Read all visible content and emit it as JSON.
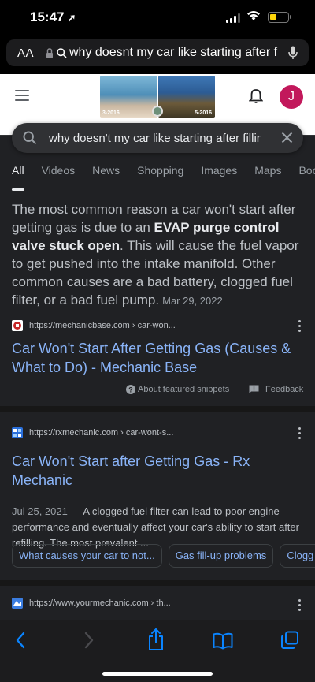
{
  "status_bar": {
    "time": "15:47"
  },
  "browser": {
    "aa_label": "AA",
    "url_text": "why doesnt my car like starting after f"
  },
  "google": {
    "doodle": {
      "left_label": "3-2016",
      "right_label": "5-2016"
    },
    "avatar_letter": "J",
    "search_query": "why doesn't my car like starting after filling",
    "tabs": [
      "All",
      "Videos",
      "News",
      "Shopping",
      "Images",
      "Maps",
      "Boo"
    ]
  },
  "featured_snippet": {
    "text_before": "The most common reason a car won't start after getting gas is due to an ",
    "bold": "EVAP purge control valve stuck open",
    "text_after": ". This will cause the fuel vapor to get pushed into the intake manifold. Other common causes are a bad battery, clogged fuel filter, or a bad fuel pump.",
    "date": "Mar 29, 2022",
    "source_url": "https://mechanicbase.com",
    "source_path": " › car-won...",
    "title": "Car Won't Start After Getting Gas (Causes & What to Do) - Mechanic Base",
    "about_label": "About featured snippets",
    "feedback_label": "Feedback"
  },
  "results": [
    {
      "url": "https://rxmechanic.com",
      "path": " › car-wont-s...",
      "title": "Car Won't Start after Getting Gas - Rx Mechanic",
      "date": "Jul 25, 2021",
      "description": " — A clogged fuel filter can lead to poor engine performance and eventually affect your car's ability to start after refilling. The most prevalent ...",
      "chips": [
        "What causes your car to not...",
        "Gas fill-up problems",
        "Clogg"
      ]
    },
    {
      "url": "https://www.yourmechanic.com",
      "path": " › th..."
    }
  ],
  "colors": {
    "background": "#202124",
    "link": "#8ab4f8",
    "avatar": "#c2185b",
    "toolbar_icons": "#0a84ff"
  },
  "icons": [
    "location-arrow-icon",
    "lock-icon",
    "search-icon",
    "microphone-icon",
    "hamburger-icon",
    "bell-icon",
    "clear-icon",
    "kebab-icon",
    "help-icon",
    "feedback-icon",
    "back-icon",
    "forward-icon",
    "share-icon",
    "bookmarks-icon",
    "tabs-icon"
  ]
}
